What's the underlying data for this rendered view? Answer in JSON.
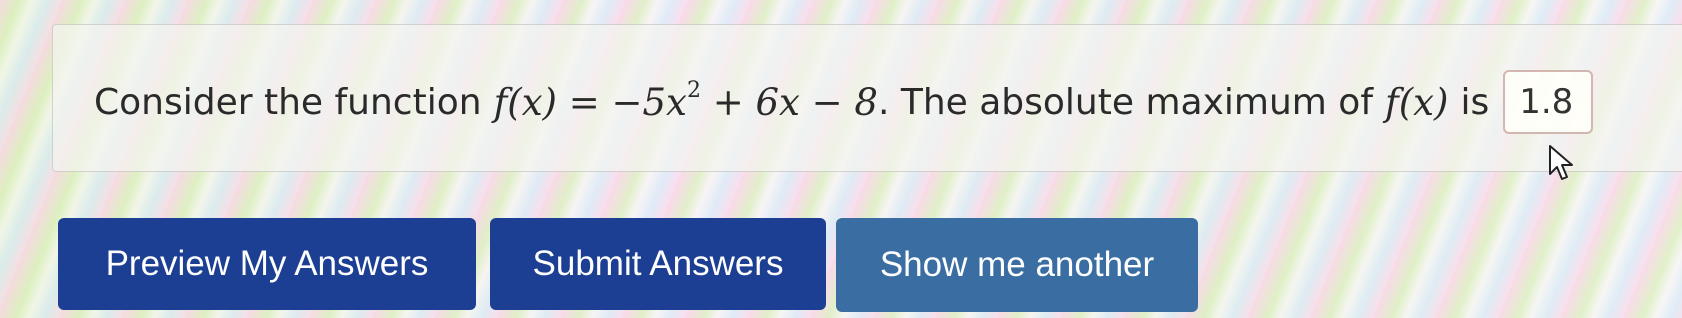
{
  "problem": {
    "prefix": "Consider the function",
    "math_lhs": "f(x) = −5x",
    "math_exponent": "2",
    "math_rest": "+ 6x − 8",
    "mid_text": ". The absolute maximum of",
    "math_fx": "f(x)",
    "suffix": "is",
    "answer_value": "1.8"
  },
  "buttons": {
    "preview": "Preview My Answers",
    "submit": "Submit Answers",
    "another": "Show me another"
  }
}
